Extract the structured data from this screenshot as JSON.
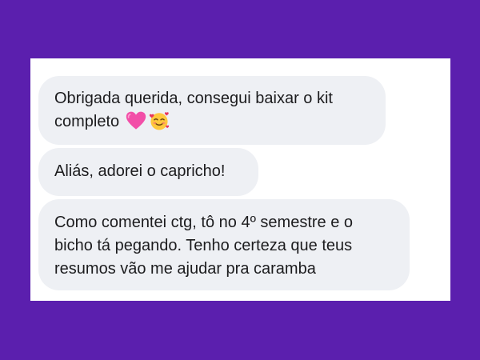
{
  "messages": [
    {
      "lines": [
        "Obrigada querida, consegui baixar o kit",
        "completo"
      ],
      "emojis": [
        "pink-heart-emoji",
        "smiling-face-with-hearts-emoji"
      ]
    },
    {
      "lines": [
        "Aliás, adorei o capricho!"
      ]
    },
    {
      "lines": [
        "Como comentei ctg, tô no 4º semestre e o",
        "bicho tá pegando. Tenho certeza que teus",
        "resumos vão me ajudar pra caramba"
      ]
    }
  ],
  "colors": {
    "background": "#5b1fae",
    "card": "#ffffff",
    "bubble": "#eef0f4",
    "text": "#1c1c1e",
    "heart": "#f24fa8",
    "emoji_face": "#ffc83d"
  }
}
